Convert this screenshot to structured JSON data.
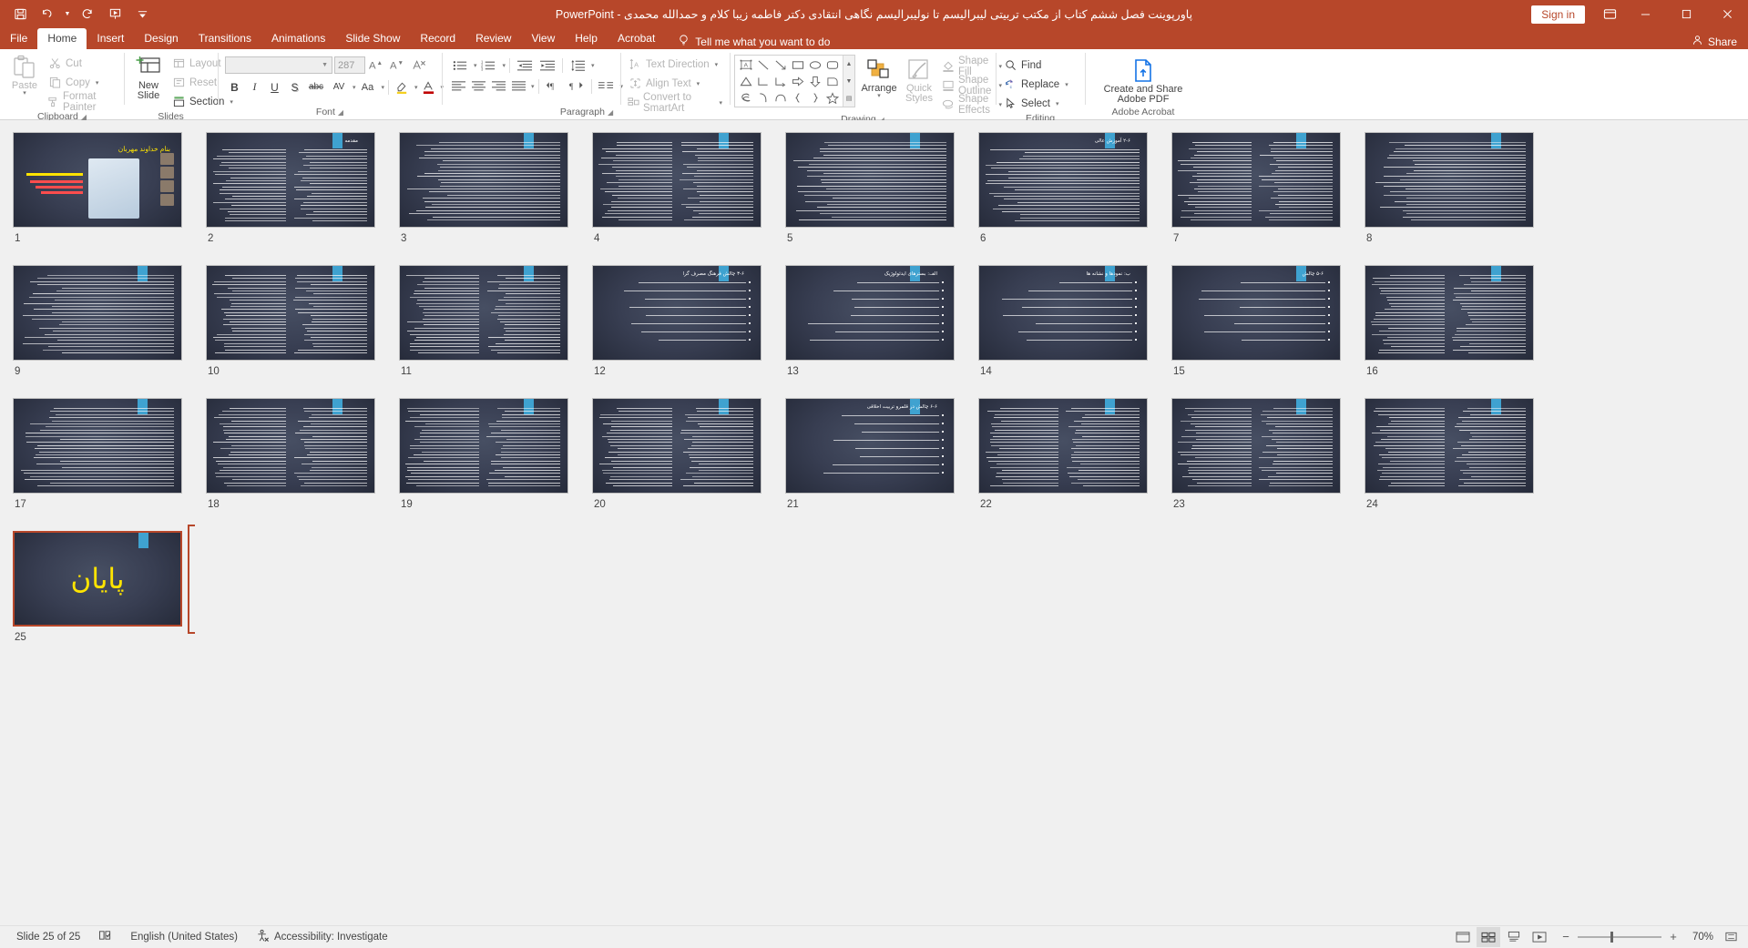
{
  "window": {
    "title_doc": "پاورپوینت فصل ششم کتاب از مکتب تربیتی لیبرالیسم تا نولیبرالیسم نگاهی انتقادی دکتر فاطمه زیبا کلام و حمدالله محمدی",
    "title_app": "PowerPoint",
    "title_sep": "-",
    "sign_in": "Sign in",
    "minimize": "—",
    "maximize": "☐",
    "close": "✕",
    "accent_color": "#b7472a"
  },
  "quick_access": [
    {
      "name": "save-icon",
      "label": "Save"
    },
    {
      "name": "undo-icon",
      "label": "Undo"
    },
    {
      "name": "redo-icon",
      "label": "Redo"
    },
    {
      "name": "start-presentation-icon",
      "label": "Start From Beginning"
    },
    {
      "name": "customize-quick-access-icon",
      "label": "Customize Quick Access Toolbar"
    }
  ],
  "tabs": [
    {
      "label": "File",
      "active": false
    },
    {
      "label": "Home",
      "active": true
    },
    {
      "label": "Insert",
      "active": false
    },
    {
      "label": "Design",
      "active": false
    },
    {
      "label": "Transitions",
      "active": false
    },
    {
      "label": "Animations",
      "active": false
    },
    {
      "label": "Slide Show",
      "active": false
    },
    {
      "label": "Record",
      "active": false
    },
    {
      "label": "Review",
      "active": false
    },
    {
      "label": "View",
      "active": false
    },
    {
      "label": "Help",
      "active": false
    },
    {
      "label": "Acrobat",
      "active": false
    }
  ],
  "tell_me": "Tell me what you want to do",
  "share": "Share",
  "ribbon": {
    "clipboard": {
      "label": "Clipboard",
      "paste": "Paste",
      "cut": "Cut",
      "copy": "Copy",
      "format_painter": "Format Painter"
    },
    "slides": {
      "label": "Slides",
      "new_slide": "New\nSlide",
      "new_slide_l1": "New",
      "new_slide_l2": "Slide",
      "layout": "Layout",
      "reset": "Reset",
      "section": "Section"
    },
    "font": {
      "label": "Font",
      "font_name_value": "",
      "font_size_value": "287",
      "bold": "B",
      "italic": "I",
      "underline": "U",
      "shadow": "S",
      "strikethrough": "abc",
      "char_spacing": "AV",
      "change_case": "Aa",
      "clear_formatting": "A",
      "text_highlight": "highlight",
      "font_color": "A"
    },
    "paragraph": {
      "label": "Paragraph",
      "text_direction": "Text Direction",
      "align_text": "Align Text",
      "convert_smartart": "Convert to SmartArt"
    },
    "drawing": {
      "label": "Drawing",
      "arrange": "Arrange",
      "quick_styles_l1": "Quick",
      "quick_styles_l2": "Styles",
      "shape_fill": "Shape Fill",
      "shape_outline": "Shape Outline",
      "shape_effects": "Shape Effects"
    },
    "editing": {
      "label": "Editing",
      "find": "Find",
      "replace": "Replace",
      "select": "Select"
    },
    "adobe": {
      "label": "Adobe Acrobat",
      "create_share_l1": "Create and Share",
      "create_share_l2": "Adobe PDF"
    }
  },
  "slides": {
    "count": 25,
    "selected": 25,
    "items": [
      {
        "num": "1",
        "kind": "title",
        "heading": "بنام خداوند مهربان"
      },
      {
        "num": "2",
        "kind": "heading",
        "heading": "مقدمه"
      },
      {
        "num": "3",
        "kind": "text",
        "heading": ""
      },
      {
        "num": "4",
        "kind": "text",
        "heading": ""
      },
      {
        "num": "5",
        "kind": "text",
        "heading": ""
      },
      {
        "num": "6",
        "kind": "heading",
        "heading": "۲-۶ آموزش عالی"
      },
      {
        "num": "7",
        "kind": "text",
        "heading": ""
      },
      {
        "num": "8",
        "kind": "text",
        "heading": ""
      },
      {
        "num": "9",
        "kind": "text",
        "heading": ""
      },
      {
        "num": "10",
        "kind": "text",
        "heading": ""
      },
      {
        "num": "11",
        "kind": "text",
        "heading": ""
      },
      {
        "num": "12",
        "kind": "bullets",
        "heading": "۳-۶ چالش فرهنگ مصرف گرا"
      },
      {
        "num": "13",
        "kind": "bullets",
        "heading": "الف: بسترهای ایدئولوژیک"
      },
      {
        "num": "14",
        "kind": "bullets",
        "heading": "ب: نمودها و نشانه ها"
      },
      {
        "num": "15",
        "kind": "bullets",
        "heading": "۵-۶ چالش"
      },
      {
        "num": "16",
        "kind": "text",
        "heading": ""
      },
      {
        "num": "17",
        "kind": "text",
        "heading": ""
      },
      {
        "num": "18",
        "kind": "text",
        "heading": ""
      },
      {
        "num": "19",
        "kind": "text",
        "heading": ""
      },
      {
        "num": "20",
        "kind": "text",
        "heading": ""
      },
      {
        "num": "21",
        "kind": "bullets",
        "heading": "۶-۶ چالش در قلمرو تربیت اخلاقی"
      },
      {
        "num": "22",
        "kind": "text",
        "heading": ""
      },
      {
        "num": "23",
        "kind": "text",
        "heading": ""
      },
      {
        "num": "24",
        "kind": "text",
        "heading": ""
      },
      {
        "num": "25",
        "kind": "end",
        "heading": "پایان"
      }
    ]
  },
  "status": {
    "slide_indicator": "Slide 25 of 25",
    "language": "English (United States)",
    "accessibility": "Accessibility: Investigate",
    "zoom_level": "70%",
    "views": [
      {
        "name": "reading-view",
        "active": false
      },
      {
        "name": "slide-sorter-view",
        "active": true
      },
      {
        "name": "notes-view",
        "active": false
      },
      {
        "name": "slideshow-view",
        "active": false
      }
    ],
    "zoom_out": "−",
    "zoom_in": "+",
    "fit_to_window": "fit-to-window"
  }
}
